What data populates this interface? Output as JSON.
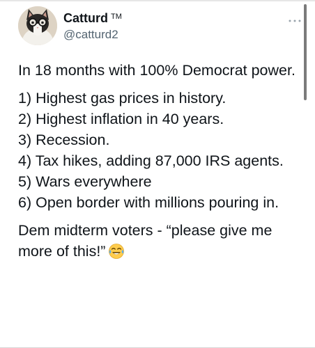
{
  "author": {
    "display_name": "Catturd",
    "trademark": "TM",
    "handle": "@catturd2",
    "avatar_icon": "cat-with-glasses-avatar"
  },
  "more_icon": "more-options-icon",
  "tweet": {
    "intro": "In 18 months with 100% Democrat power.",
    "list": [
      "1) Highest gas prices in history.",
      "2) Highest inflation in 40 years.",
      "3) Recession.",
      "4) Tax hikes, adding 87,000 IRS agents.",
      "5) Wars everywhere",
      "6) Open border with millions pouring in."
    ],
    "closing": "Dem midterm voters - “please give me more of this!”",
    "closing_emoji": "laughing-crying-emoji"
  },
  "colors": {
    "text": "#0f1419",
    "secondary": "#536471",
    "emoji_face": "#ffcc4d"
  }
}
